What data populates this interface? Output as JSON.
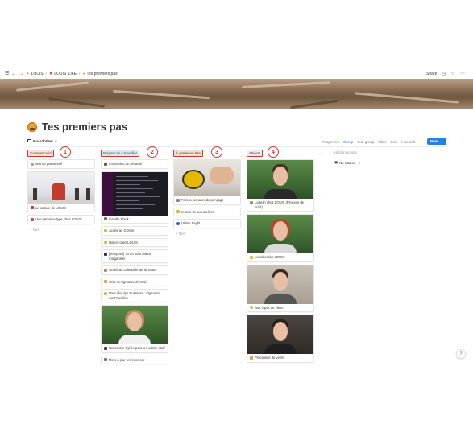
{
  "topbar": {
    "breadcrumbs": [
      "LOUIS",
      "LOUIS' LIFE",
      "Tes premiers pas"
    ],
    "share_label": "Share"
  },
  "page": {
    "title": "Tes premiers pas",
    "view_label": "Board View"
  },
  "view_actions": {
    "properties": "Properties",
    "group": "Group",
    "subgroup": "Sub-group",
    "filter": "Filter",
    "sort": "Sort",
    "search": "Search",
    "more": "···",
    "new_label": "New"
  },
  "columns": [
    {
      "label": "Commence ici",
      "number": "1",
      "tag_color": "#f8e2dc",
      "cards": [
        {
          "text": "Mot de passe Wifi",
          "emoji_color": "#c9a36a",
          "image": null
        },
        {
          "text": "La culture de LOUIS",
          "emoji_color": "#d8352a",
          "image": "snow"
        },
        {
          "text": "Une semaine type chez LOUIS",
          "emoji_color": "#d04a4a",
          "image": null
        }
      ],
      "add_label": "+ New"
    },
    {
      "label": "Prépare toi à travailler",
      "number": "2",
      "tag_color": "#dbe9f3",
      "cards": [
        {
          "text": "Instruction de sécurité",
          "emoji_color": "#7a5a3a",
          "image": null
        },
        {
          "text": "Installe Slack",
          "emoji_color": "#8a6d4a",
          "image": "screen"
        },
        {
          "text": "Accès au GDrive",
          "emoji_color": "#e6b73a",
          "image": null
        },
        {
          "text": "Notion chez LOUIS",
          "emoji_color": "#e6b73a",
          "image": null
        },
        {
          "text": "[Template] To do pour mieux s'organiser",
          "emoji_color": "#333333",
          "image": null
        },
        {
          "text": "Accès au calendrier de la Team",
          "emoji_color": "#b38a5c",
          "image": null
        },
        {
          "text": "Crée ta signature d'email",
          "emoji_color": "#e6a23a",
          "image": null
        },
        {
          "text": "Pour l'équipe Business : Signature sur Pipedrive",
          "emoji_color": "#e6b73a",
          "image": null
        },
        {
          "text": "Rencontre Sylvie pour tes admin stuff",
          "emoji_color": "#444444",
          "image": "woman"
        },
        {
          "text": "Mets à jour tes infos sur",
          "emoji_color": "#3a7ad8",
          "image": null
        }
      ]
    },
    {
      "label": "À garder en tête",
      "number": "3",
      "tag_color": "#efe1d3",
      "cards": [
        {
          "text": "Fais ta semaine de ponçage",
          "emoji_color": "#888888",
          "image": "desk"
        },
        {
          "text": "Inscris-toi aux ateliers",
          "emoji_color": "#e6b73a",
          "image": null
        },
        {
          "text": "Utilise Payfit",
          "emoji_color": "#2f5dd8",
          "image": null
        }
      ],
      "add_label": "+ New"
    },
    {
      "label": "Ateliers",
      "number": "4",
      "tag_color": "#ececea",
      "cards": [
        {
          "text": "La tech chez LOUIS (Process de prod)",
          "emoji_color": "#b38a5c",
          "image": "man-beard"
        },
        {
          "text": "La collection LOUIS",
          "emoji_color": "#e6b73a",
          "image": "woman-red"
        },
        {
          "text": "Nos types de client",
          "emoji_color": "#e6b73a",
          "image": "man-indoor"
        },
        {
          "text": "Processus de vente",
          "emoji_color": "#e6a23a",
          "image": "man-dark"
        }
      ]
    }
  ],
  "hidden_groups": {
    "title": "Hidden groups",
    "no_status_label": "No Status",
    "no_status_count": "0"
  },
  "help_label": "?"
}
